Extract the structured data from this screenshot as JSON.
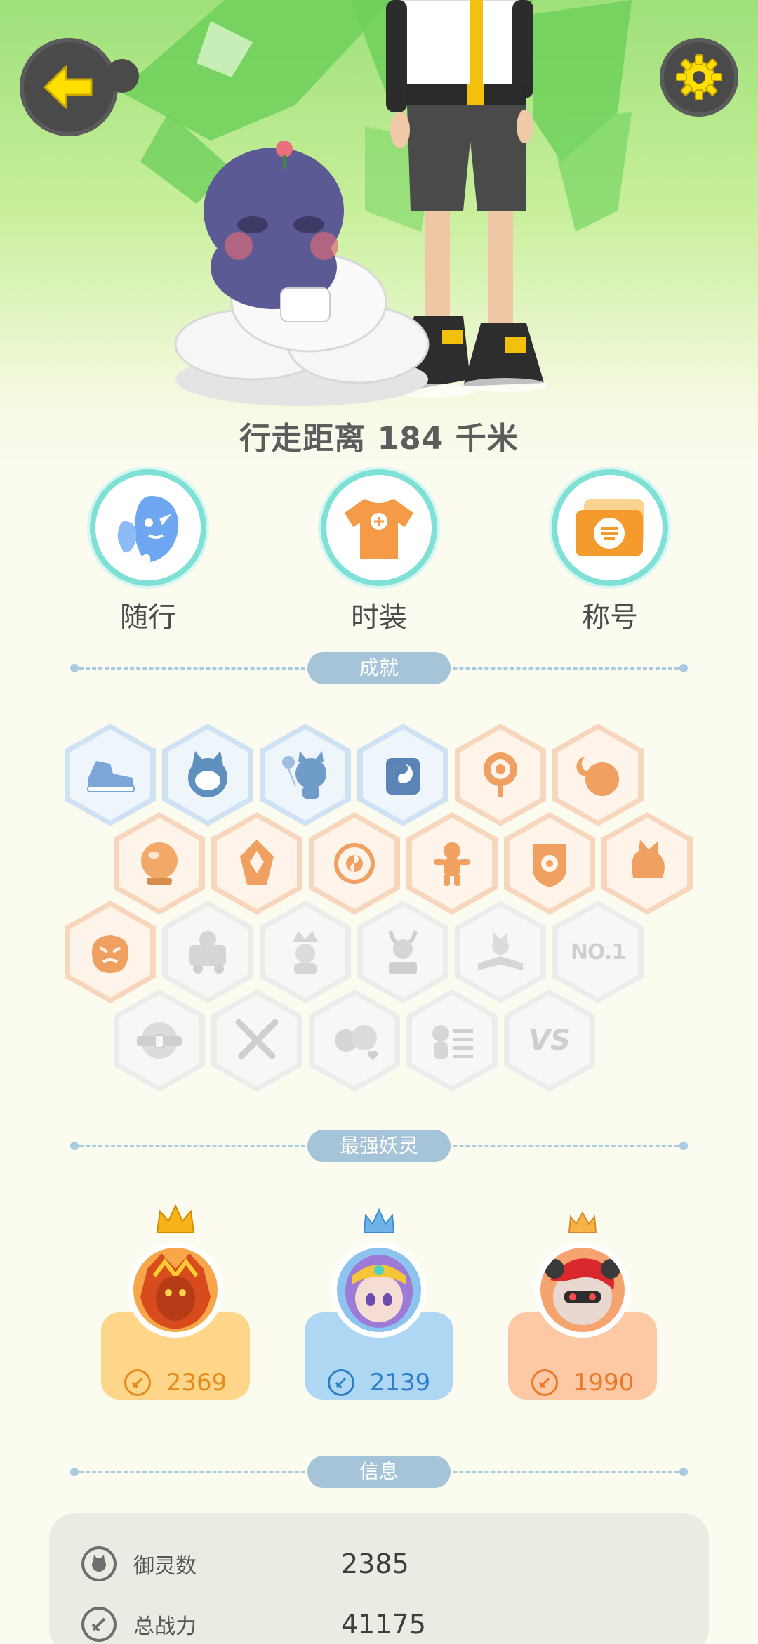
{
  "hero": {
    "walk_distance": "行走距离 184 千米"
  },
  "quick_buttons": [
    {
      "label": "随行",
      "icon": "ghost-companion-icon"
    },
    {
      "label": "时装",
      "icon": "tshirt-icon"
    },
    {
      "label": "称号",
      "icon": "title-card-icon"
    }
  ],
  "sections": {
    "achievements": "成就",
    "strongest_spirits": "最强妖灵",
    "info": "信息"
  },
  "achievements": {
    "rows": [
      [
        "sneaker-badge",
        "blue-cat-badge",
        "cat-balloon-badge",
        "yin-yang-scroll-badge",
        "orange-target-badge",
        "moon-sun-badge"
      ],
      [
        "fortune-orb-badge",
        "crystal-badge",
        "yin-yang-orb-badge",
        "gingerbread-badge",
        "shield-badge",
        "fox-badge"
      ],
      [
        "angry-bag-badge",
        "cat-cart-badge-locked",
        "king-crown-badge-locked",
        "devil-statue-badge-locked",
        "book-cat-badge-locked",
        "no1-badge-locked"
      ],
      [
        "seal-belt-badge-locked",
        "crossed-swords-badge-locked",
        "couple-hearts-badge-locked",
        "cat-list-badge-locked",
        "vs-badge-locked"
      ]
    ],
    "no1_text": "NO.1",
    "vs_text": "VS"
  },
  "strongest_spirits": [
    {
      "power": "2369",
      "theme": "gold",
      "icon": "fire-dragon-avatar"
    },
    {
      "power": "2139",
      "theme": "blue",
      "icon": "purple-princess-avatar"
    },
    {
      "power": "1990",
      "theme": "orange",
      "icon": "red-hair-rat-avatar"
    }
  ],
  "info": {
    "rows": [
      {
        "label": "御灵数",
        "value": "2385",
        "icon": "spirit-count-icon"
      },
      {
        "label": "总战力",
        "value": "41175",
        "icon": "sword-power-icon"
      }
    ]
  },
  "colors": {
    "bg": "#fbfbf0",
    "hero_green": "#9ee07a",
    "accent_teal": "#7fe0d6",
    "header_pill": "#a6c4d8",
    "gold_card": "#fdd68a",
    "blue_card": "#aed7f4",
    "orange_card": "#fdc9a4"
  }
}
